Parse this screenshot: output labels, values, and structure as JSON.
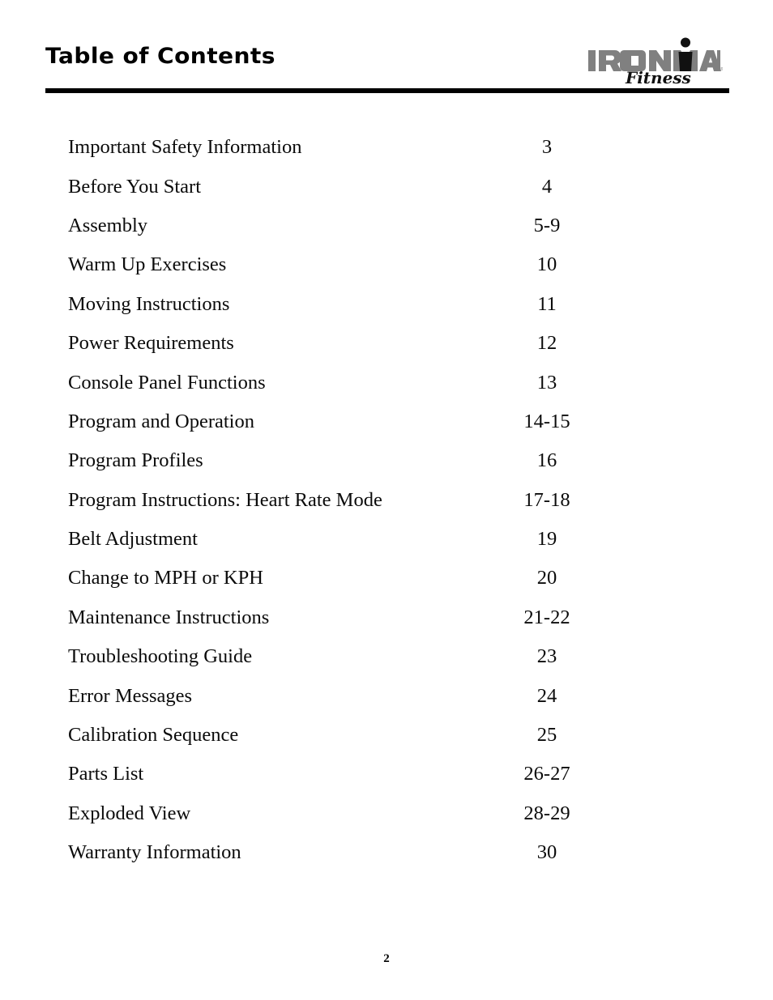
{
  "header": {
    "title": "Table of Contents",
    "logo": {
      "wordmark": "IRONMAN",
      "script": "Fitness",
      "trademark": "®",
      "wordmark_color": "#808080",
      "script_color": "#111111",
      "figure_color": "#111111"
    },
    "rule_color": "#000000"
  },
  "toc": {
    "entries": [
      {
        "title": "Important Safety Information",
        "page": "3"
      },
      {
        "title": "Before You Start",
        "page": "4"
      },
      {
        "title": "Assembly",
        "page": "5-9"
      },
      {
        "title": "Warm Up Exercises",
        "page": "10"
      },
      {
        "title": "Moving Instructions",
        "page": "11"
      },
      {
        "title": "Power Requirements",
        "page": "12"
      },
      {
        "title": "Console Panel Functions",
        "page": "13"
      },
      {
        "title": "Program and Operation",
        "page": "14-15"
      },
      {
        "title": "Program Profiles",
        "page": "16"
      },
      {
        "title": "Program Instructions: Heart Rate Mode",
        "page": "17-18"
      },
      {
        "title": "Belt Adjustment",
        "page": "19"
      },
      {
        "title": "Change to MPH or KPH",
        "page": "20"
      },
      {
        "title": "Maintenance Instructions",
        "page": "21-22"
      },
      {
        "title": "Troubleshooting Guide",
        "page": "23"
      },
      {
        "title": "Error Messages",
        "page": "24"
      },
      {
        "title": "Calibration Sequence",
        "page": "25"
      },
      {
        "title": "Parts List",
        "page": "26-27"
      },
      {
        "title": "Exploded View",
        "page": "28-29"
      },
      {
        "title": "Warranty Information",
        "page": "30"
      }
    ]
  },
  "footer": {
    "page_number": "2"
  }
}
